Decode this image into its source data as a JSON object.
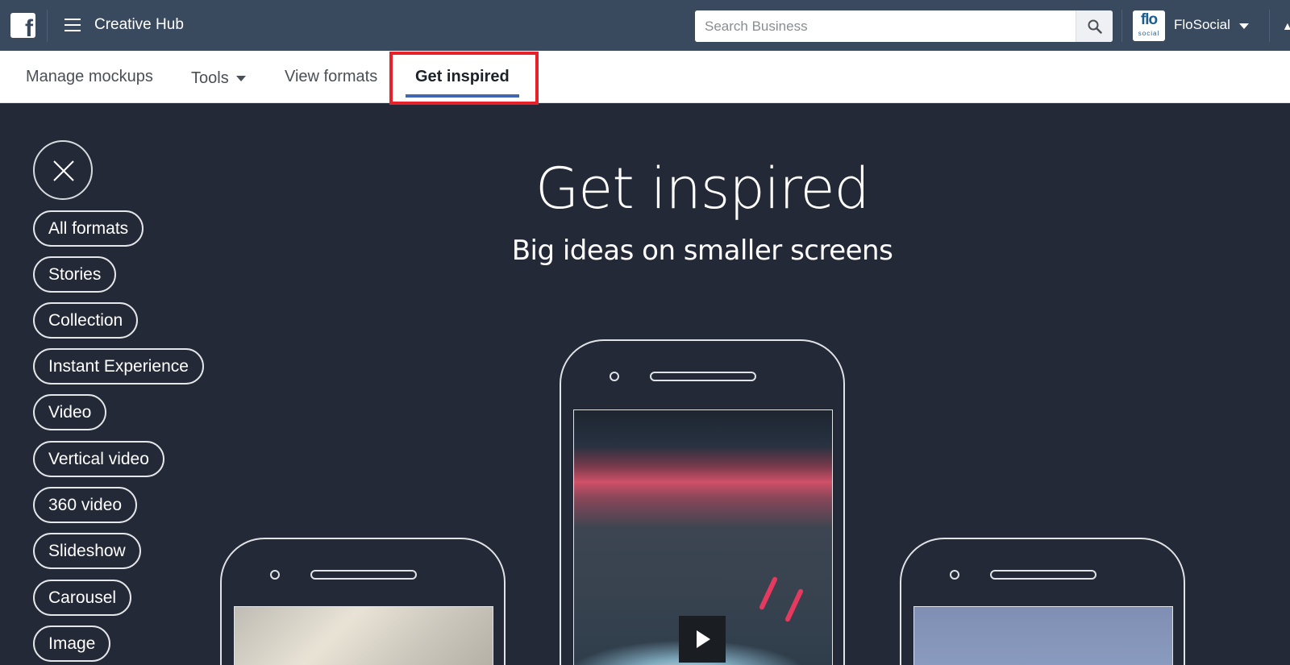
{
  "header": {
    "logo_letter": "f",
    "app_title": "Creative Hub",
    "search_placeholder": "Search Business",
    "avatar_text_top": "flo",
    "avatar_text_bottom": "social",
    "account_name": "FloSocial"
  },
  "tabs": {
    "manage": "Manage mockups",
    "tools": "Tools",
    "view": "View formats",
    "inspired": "Get inspired",
    "active": "Get inspired"
  },
  "hero": {
    "title": "Get inspired",
    "subtitle": "Big ideas on smaller screens"
  },
  "filters": [
    "All formats",
    "Stories",
    "Collection",
    "Instant Experience",
    "Video",
    "Vertical video",
    "360 video",
    "Slideshow",
    "Carousel",
    "Image"
  ],
  "colors": {
    "topbar": "#3a4a5e",
    "background": "#232936",
    "tab_underline": "#4267b2",
    "highlight": "#e8202a"
  },
  "icons": {
    "menu": "hamburger-icon",
    "search": "search-icon",
    "close": "close-icon",
    "play": "play-icon"
  }
}
